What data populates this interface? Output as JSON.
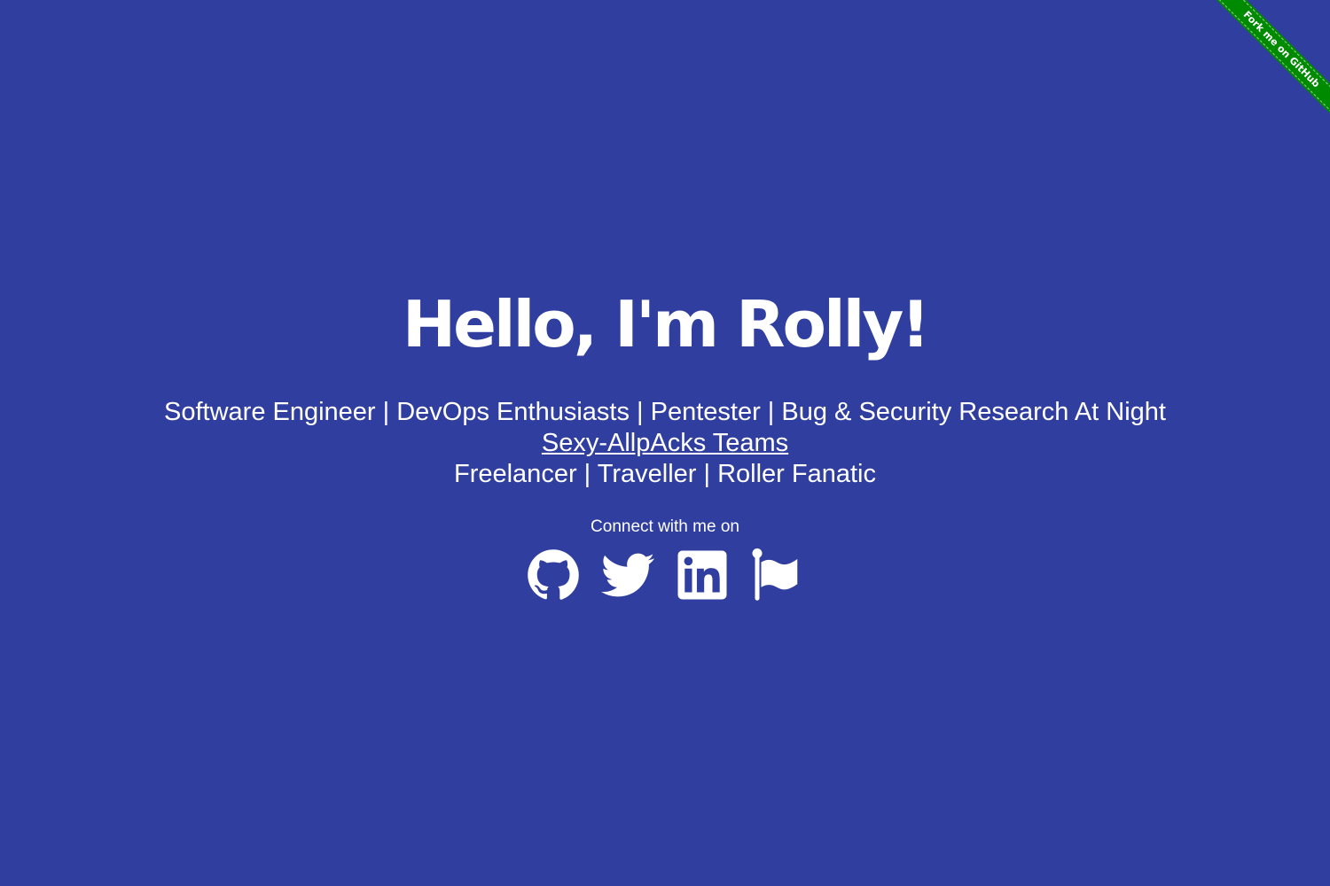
{
  "ribbon": {
    "label": "Fork me on GitHub",
    "color": "#008a00"
  },
  "page": {
    "background": "#303f9f",
    "text_color": "#ffffff"
  },
  "hero": {
    "title": "Hello, I'm Rolly!",
    "line1": "Software Engineer | DevOps Enthusiasts | Pentester | Bug & Security Research At Night",
    "team_link": "Sexy-AllpAcks Teams",
    "line3": "Freelancer | Traveller | Roller Fanatic",
    "connect_label": "Connect with me on"
  },
  "socials": [
    {
      "name": "github-icon"
    },
    {
      "name": "twitter-icon"
    },
    {
      "name": "linkedin-icon"
    },
    {
      "name": "flag-icon"
    }
  ]
}
